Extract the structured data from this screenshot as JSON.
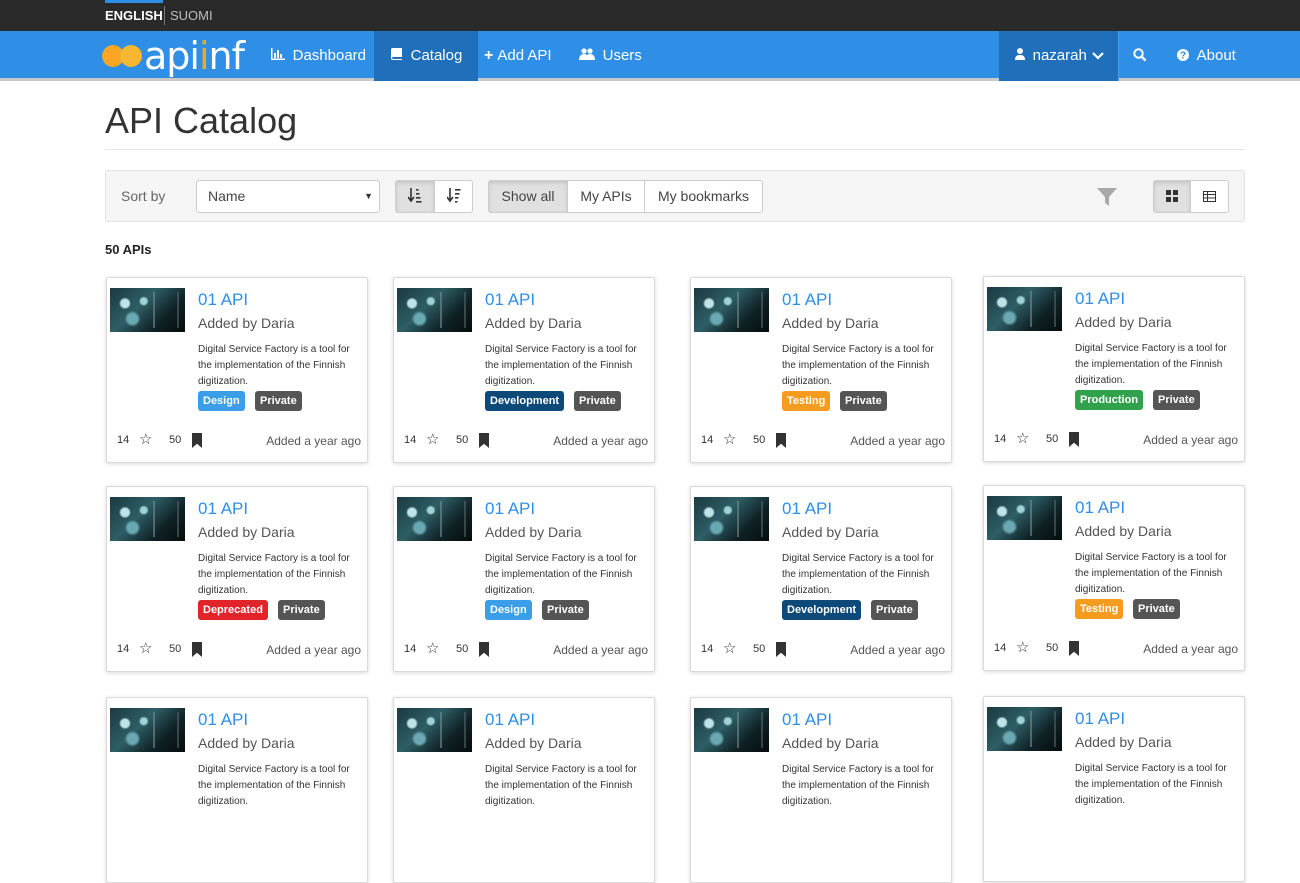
{
  "languages": [
    "ENGLISH",
    "SUOMI"
  ],
  "nav": {
    "logo_text_a": "api",
    "logo_text_b": "nf",
    "logo_text_i": "i",
    "dashboard": "Dashboard",
    "catalog": "Catalog",
    "add_api": "Add API",
    "users": "Users",
    "user": "nazarah",
    "about": "About"
  },
  "page": {
    "title": "API Catalog",
    "count": "50 APIs"
  },
  "toolbar": {
    "sort_by": "Sort by",
    "sort_value": "Name",
    "show_all": "Show all",
    "my_apis": "My APIs",
    "my_bookmarks": "My bookmarks"
  },
  "colors": {
    "Design": "#3a9ee8",
    "Development": "#0d4a7a",
    "Testing": "#f59b1d",
    "Production": "#31a24c",
    "Deprecated": "#e0242a",
    "Private": "#555555"
  },
  "cards": [
    {
      "title": "01 API",
      "author": "Added by Daria",
      "desc": "Digital Service Factory is a tool for the implementation of the Finnish digitization.",
      "lifecycle": "Design",
      "visibility": "Private",
      "rating": "14",
      "bookmarks": "50",
      "added": "Added a year ago"
    },
    {
      "title": "01 API",
      "author": "Added by Daria",
      "desc": "Digital Service Factory is a tool for the implementation of the Finnish digitization.",
      "lifecycle": "Development",
      "visibility": "Private",
      "rating": "14",
      "bookmarks": "50",
      "added": "Added a year ago"
    },
    {
      "title": "01 API",
      "author": "Added by Daria",
      "desc": "Digital Service Factory is a tool for the implementation of the Finnish digitization.",
      "lifecycle": "Testing",
      "visibility": "Private",
      "rating": "14",
      "bookmarks": "50",
      "added": "Added a year ago"
    },
    {
      "title": "01 API",
      "author": "Added by Daria",
      "desc": "Digital Service Factory is a tool for the implementation of the Finnish digitization.",
      "lifecycle": "Production",
      "visibility": "Private",
      "rating": "14",
      "bookmarks": "50",
      "added": "Added a year ago"
    },
    {
      "title": "01 API",
      "author": "Added by Daria",
      "desc": "Digital Service Factory is a tool for the implementation of the Finnish digitization.",
      "lifecycle": "Deprecated",
      "visibility": "Private",
      "rating": "14",
      "bookmarks": "50",
      "added": "Added a year ago"
    },
    {
      "title": "01 API",
      "author": "Added by Daria",
      "desc": "Digital Service Factory is a tool for the implementation of the Finnish digitization.",
      "lifecycle": "Design",
      "visibility": "Private",
      "rating": "14",
      "bookmarks": "50",
      "added": "Added a year ago"
    },
    {
      "title": "01 API",
      "author": "Added by Daria",
      "desc": "Digital Service Factory is a tool for the implementation of the Finnish digitization.",
      "lifecycle": "Development",
      "visibility": "Private",
      "rating": "14",
      "bookmarks": "50",
      "added": "Added a year ago"
    },
    {
      "title": "01 API",
      "author": "Added by Daria",
      "desc": "Digital Service Factory is a tool for the implementation of the Finnish digitization.",
      "lifecycle": "Testing",
      "visibility": "Private",
      "rating": "14",
      "bookmarks": "50",
      "added": "Added a year ago"
    },
    {
      "title": "01 API",
      "author": "Added by Daria",
      "desc": "Digital Service Factory is a tool for the implementation of the Finnish digitization.",
      "lifecycle": "",
      "visibility": "",
      "rating": "",
      "bookmarks": "",
      "added": ""
    },
    {
      "title": "01 API",
      "author": "Added by Daria",
      "desc": "Digital Service Factory is a tool for the implementation of the Finnish digitization.",
      "lifecycle": "",
      "visibility": "",
      "rating": "",
      "bookmarks": "",
      "added": ""
    },
    {
      "title": "01 API",
      "author": "Added by Daria",
      "desc": "Digital Service Factory is a tool for the implementation of the Finnish digitization.",
      "lifecycle": "",
      "visibility": "",
      "rating": "",
      "bookmarks": "",
      "added": ""
    },
    {
      "title": "01 API",
      "author": "Added by Daria",
      "desc": "Digital Service Factory is a tool for the implementation of the Finnish digitization.",
      "lifecycle": "",
      "visibility": "",
      "rating": "",
      "bookmarks": "",
      "added": ""
    }
  ]
}
